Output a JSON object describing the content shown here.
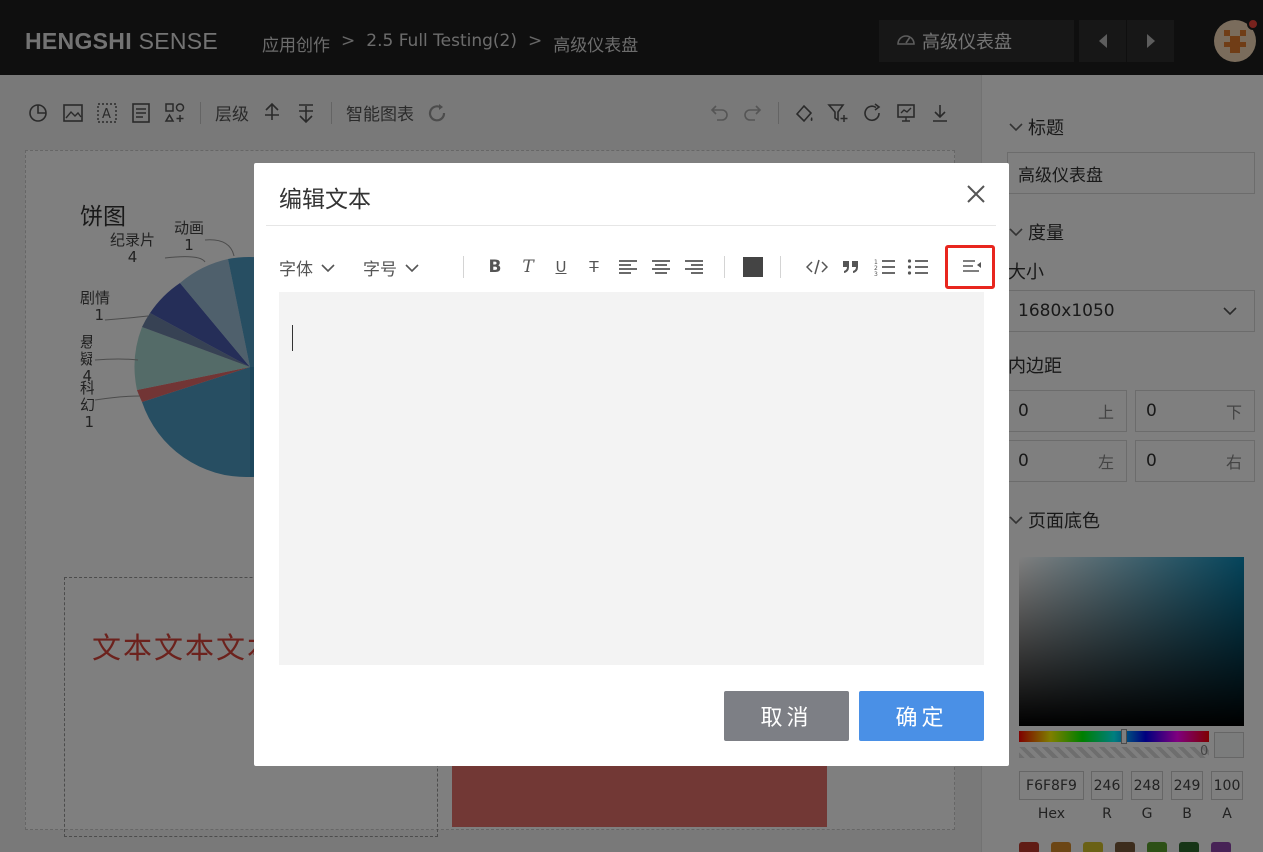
{
  "header": {
    "logo_bold": "HENGSHI",
    "logo_light": " SENSE",
    "breadcrumb": [
      "应用创作",
      "2.5 Full Testing(2)",
      "高级仪表盘"
    ],
    "breadcrumb_sep": ">",
    "dashboard_select": "高级仪表盘"
  },
  "toolbar": {
    "layer_label": "层级",
    "smart_chart_label": "智能图表"
  },
  "canvas": {
    "chart_title": "饼图",
    "pie_labels": [
      {
        "name": "纪录片",
        "value": "4"
      },
      {
        "name": "动画",
        "value": "1"
      },
      {
        "name": "剧情",
        "value": "1"
      },
      {
        "name": "悬疑",
        "value": "4"
      },
      {
        "name": "科幻",
        "value": "1"
      }
    ],
    "text_widget": "文本文本文本"
  },
  "right_panel": {
    "title_section": "标题",
    "title_value": "高级仪表盘",
    "measure_section": "度量",
    "size_label": "大小",
    "size_value": "1680x1050",
    "padding_label": "内边距",
    "padding": {
      "top": {
        "value": "0",
        "suffix": "上"
      },
      "bottom": {
        "value": "0",
        "suffix": "下"
      },
      "left": {
        "value": "0",
        "suffix": "左"
      },
      "right": {
        "value": "0",
        "suffix": "右"
      }
    },
    "bg_section": "页面底色",
    "alpha_value": "0",
    "color": {
      "hex": "F6F8F9",
      "r": "246",
      "g": "248",
      "b": "249",
      "a": "100",
      "hex_label": "Hex",
      "r_label": "R",
      "g_label": "G",
      "b_label": "B",
      "a_label": "A"
    },
    "preset_colors": [
      "#c0392b",
      "#d98c2b",
      "#d4c22b",
      "#7a5a3a",
      "#5aa02c",
      "#2f6b2f",
      "#8e44ad"
    ]
  },
  "dialog": {
    "title": "编辑文本",
    "font_label": "字体",
    "size_label": "字号",
    "toolbar_icons": [
      "bold-icon",
      "italic-icon",
      "underline-icon",
      "strikethrough-icon",
      "align-left-icon",
      "align-center-icon",
      "align-right-icon",
      "text-color-icon",
      "code-icon",
      "quote-icon",
      "ordered-list-icon",
      "unordered-list-icon",
      "indent-icon"
    ],
    "editor_content": "",
    "cancel_label": "取消",
    "ok_label": "确定"
  },
  "colors": {
    "header_bg": "#1f1f1f",
    "accent": "#4a90e6",
    "cancel": "#7d7f85",
    "highlight": "#e8261e",
    "text_widget": "#d9443a"
  }
}
